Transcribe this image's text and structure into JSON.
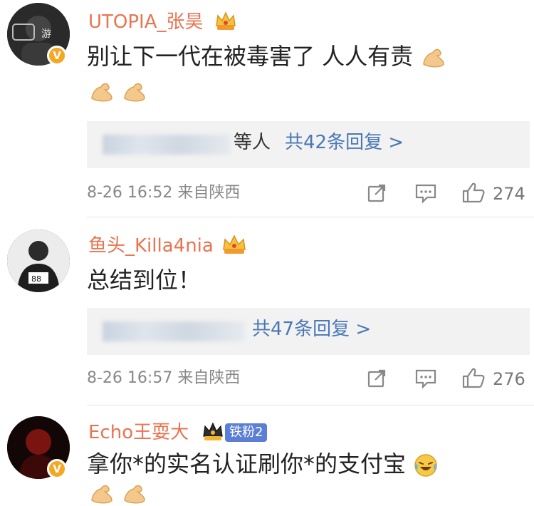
{
  "comments": [
    {
      "username": "UTOPIA_张昊",
      "text": "别让下一代在被毒害了 人人有责",
      "reply_suffix": "等人",
      "reply_link": "共42条回复 >",
      "timestamp": "8-26 16:52 来自陕西",
      "likes": "274"
    },
    {
      "username": "鱼头_Killa4nia",
      "text": "总结到位！",
      "reply_suffix": "",
      "reply_link": "共47条回复 >",
      "timestamp": "8-26 16:57 来自陕西",
      "likes": "276"
    },
    {
      "username": "Echo王耍大",
      "badge": "铁粉2",
      "text": "拿你*的实名认证刷你*的支付宝"
    }
  ],
  "colors": {
    "username": "#eb7350",
    "link": "#4a78b5",
    "meta": "#888888",
    "verified": "#f5a623"
  }
}
